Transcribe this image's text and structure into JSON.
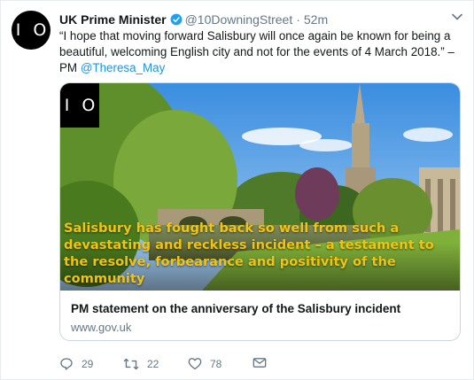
{
  "account": {
    "avatar_text": "I O",
    "name": "UK Prime Minister",
    "handle": "@10DowningStreet",
    "separator": "·",
    "time": "52m"
  },
  "tweet": {
    "text": "“I hope that moving forward Salisbury will once again be known for being a beautiful, welcoming English city and not for the events of 4 March 2018.” – PM",
    "mention": "@Theresa_May"
  },
  "card": {
    "logo_text": "I O",
    "overlay_text": "Salisbury has fought back so well from such a devastating and reckless incident – a testament to the resolve, forbearance and positivity of the community",
    "title": "PM statement on the anniversary of the Salisbury incident",
    "url": "www.gov.uk"
  },
  "actions": {
    "reply_count": "29",
    "retweet_count": "22",
    "like_count": "78"
  },
  "colors": {
    "link": "#1b95e0",
    "verified": "#1da1f2",
    "muted": "#657786",
    "overlay_text": "#f1c40f"
  },
  "icons": [
    "verified-badge-icon",
    "chevron-down-icon",
    "reply-icon",
    "retweet-icon",
    "like-icon",
    "direct-message-icon"
  ]
}
